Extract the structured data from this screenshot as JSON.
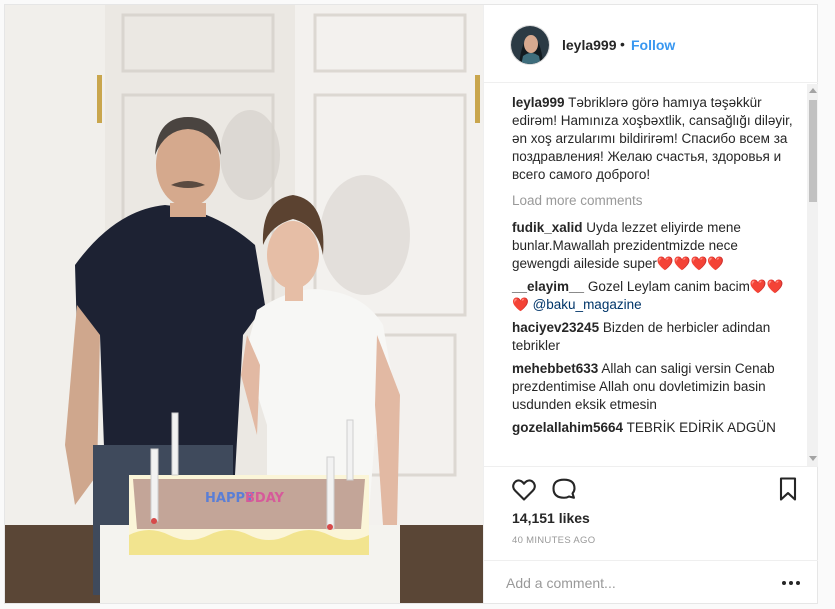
{
  "post": {
    "photo_alt": "Post photo"
  },
  "header": {
    "username": "leyla999",
    "separator": "•",
    "follow_label": "Follow"
  },
  "caption": {
    "username": "leyla999",
    "text": "Təbriklərə görə hamıya təşəkkür edirəm! Hamınıza xoşbəxtlik, cansağlığı diləyir, ən xoş arzularımı bildirirəm! Спасибо всем за поздравления! Желаю счастья, здоровья и всего самого доброго!"
  },
  "load_more_label": "Load more comments",
  "comments": [
    {
      "username": "fudik_xalid",
      "text": "Uyda lezzet eliyirde mene bunlar.Mawallah prezidentmizde nece gewengdi aileside super❤️❤️❤️❤️"
    },
    {
      "username": "__elayim__",
      "text": "Gozel Leylam canim bacim❤️❤️❤️",
      "mention": "@baku_magazine"
    },
    {
      "username": "haciyev23245",
      "text": "Bizden de herbicler adindan tebrikler"
    },
    {
      "username": "mehebbet633",
      "text": "Allah can saligi versin Cenab prezdentimise Allah onu dovletimizin basin usdunden eksik etmesin"
    },
    {
      "username": "gozelallahim5664",
      "text": "TEBRİK EDİRİK ADGÜN"
    }
  ],
  "actions": {
    "like_icon": "heart-icon",
    "comment_icon": "comment-bubble-icon",
    "save_icon": "bookmark-icon"
  },
  "likes_text": "14,151 likes",
  "timestamp": "40 MINUTES AGO",
  "add_comment": {
    "placeholder": "Add a comment..."
  },
  "colors": {
    "link": "#3897f0",
    "muted": "#999999",
    "text": "#262626"
  }
}
